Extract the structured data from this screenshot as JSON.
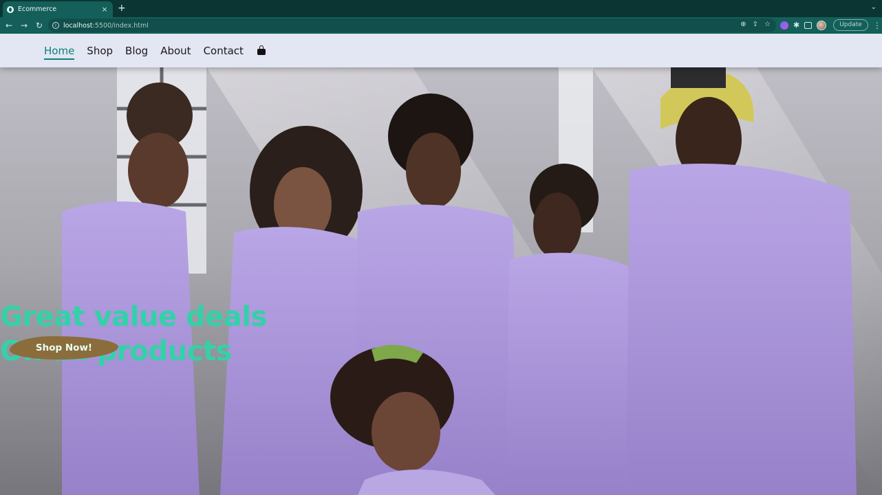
{
  "browser": {
    "tab_title": "Ecommerce",
    "new_tab_symbol": "+",
    "close_symbol": "×",
    "url_host": "localhost",
    "url_path": ":5500/index.html",
    "update_label": "Update"
  },
  "nav": {
    "links": [
      {
        "label": "Home",
        "active": true
      },
      {
        "label": "Shop"
      },
      {
        "label": "Blog"
      },
      {
        "label": "About"
      },
      {
        "label": "Contact"
      }
    ],
    "cart_icon": "shopping-bag-icon"
  },
  "hero": {
    "line1": "Great value deals",
    "line2": "On all products",
    "cta_label": "Shop Now!",
    "accent_color": "#34d1a8",
    "button_color": "#8a6d3b"
  },
  "colors": {
    "chrome_bg": "#0b3532",
    "toolbar_bg": "#145f5a",
    "nav_bg": "#e3e6f3",
    "nav_active": "#088178"
  }
}
